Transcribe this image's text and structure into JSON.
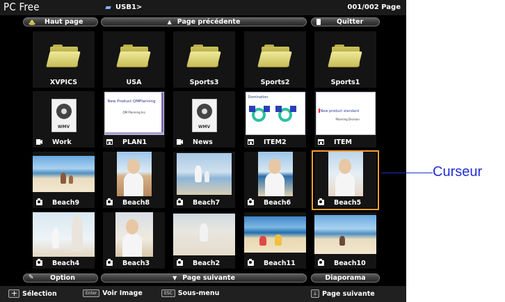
{
  "header": {
    "app_title": "PC Free",
    "path": "USB1>",
    "page_count": "001/002 Page"
  },
  "top_bar": {
    "home": "Haut page",
    "prev_page": "Page précédente",
    "quit": "Quitter"
  },
  "grid": [
    {
      "label": "XVPICS",
      "type": "folder"
    },
    {
      "label": "USA",
      "type": "folder"
    },
    {
      "label": "Sports3",
      "type": "folder"
    },
    {
      "label": "Sports2",
      "type": "folder"
    },
    {
      "label": "Sports1",
      "type": "folder"
    },
    {
      "label": "Work",
      "type": "video"
    },
    {
      "label": "PLAN1",
      "type": "doc",
      "slide_title": "New Product QMPlanning",
      "slide_sub": "QM Planning Inc."
    },
    {
      "label": "News",
      "type": "video"
    },
    {
      "label": "ITEM2",
      "type": "doc",
      "slide_title": "Domination"
    },
    {
      "label": "ITEM",
      "type": "doc",
      "slide_title": "New product standard",
      "slide_sub": "Planning Division"
    },
    {
      "label": "Beach9",
      "type": "photo"
    },
    {
      "label": "Beach8",
      "type": "photo"
    },
    {
      "label": "Beach7",
      "type": "photo"
    },
    {
      "label": "Beach6",
      "type": "photo"
    },
    {
      "label": "Beach5",
      "type": "photo",
      "selected": true
    },
    {
      "label": "Beach4",
      "type": "photo"
    },
    {
      "label": "Beach3",
      "type": "photo"
    },
    {
      "label": "Beach2",
      "type": "photo"
    },
    {
      "label": "Beach11",
      "type": "photo"
    },
    {
      "label": "Beach10",
      "type": "photo"
    }
  ],
  "bottom_bar": {
    "option": "Option",
    "next_page": "Page suivante",
    "slideshow": "Diaporama"
  },
  "footer": {
    "select": "Sélection",
    "enter_key": "Enter",
    "view_image": "Voir Image",
    "esc_key": "ESC",
    "submenu": "Sous-menu",
    "next_page": "Page suivante"
  },
  "callout": "Curseur",
  "colors": {
    "cursor": "#f0a030",
    "callout": "#1f2fd6"
  }
}
